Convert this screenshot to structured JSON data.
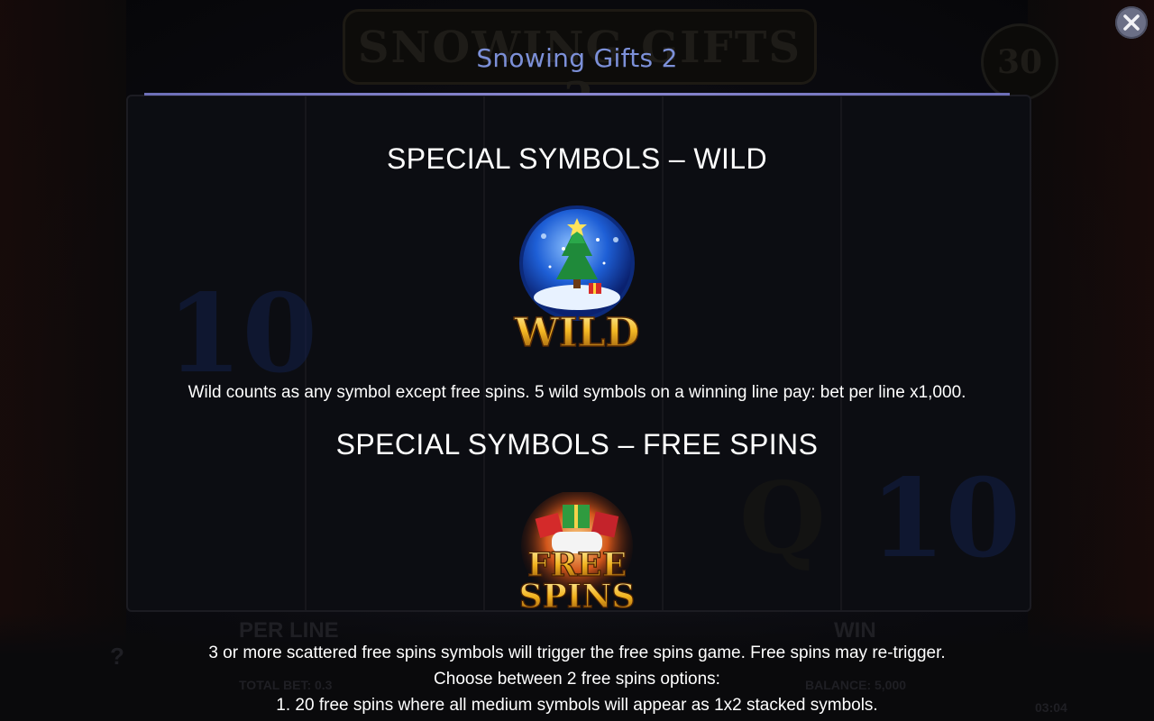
{
  "background": {
    "game_title": "SNOWING GIFTS 2",
    "lines_badge": "30",
    "ghost_labels": {
      "per_line": "PER LINE",
      "win": "WIN",
      "total_bet": "TOTAL BET: 0.3",
      "balance": "BALANCE: 5,000",
      "clock": "03:04",
      "help": "?"
    }
  },
  "close_button": {
    "icon": "close-icon"
  },
  "panel": {
    "title": "Snowing Gifts 2",
    "accent_color": "#7c90d8"
  },
  "wild_section": {
    "heading": "SPECIAL SYMBOLS – WILD",
    "symbol_label": "WILD",
    "description": "Wild counts as any symbol except free spins. 5 wild symbols on a winning line pay: bet per line x1,000."
  },
  "free_spins_section": {
    "heading": "SPECIAL SYMBOLS – FREE SPINS",
    "symbol_label_line1": "FREE",
    "symbol_label_line2": "SPINS",
    "description_lines": [
      "3 or more scattered free spins symbols will trigger the free spins game. Free spins may re-trigger.",
      "Choose between 2 free spins options:",
      "1. 20 free spins where all medium symbols will appear as 1x2 stacked symbols."
    ]
  }
}
